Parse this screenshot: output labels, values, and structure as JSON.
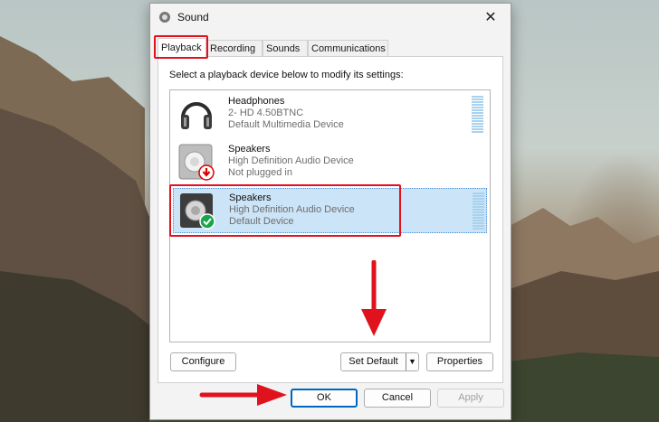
{
  "dialog": {
    "title": "Sound",
    "close_glyph": "✕"
  },
  "tabs": [
    {
      "label": "Playback",
      "active": true
    },
    {
      "label": "Recording"
    },
    {
      "label": "Sounds"
    },
    {
      "label": "Communications"
    }
  ],
  "instruction": "Select a playback device below to modify its settings:",
  "devices": [
    {
      "name": "Headphones",
      "description": "2- HD 4.50BTNC",
      "status": "Default Multimedia Device",
      "icon": "headphones-icon",
      "badge": "none"
    },
    {
      "name": "Speakers",
      "description": "High Definition Audio Device",
      "status": "Not plugged in",
      "icon": "speaker-icon",
      "badge": "unplugged-arrow-icon"
    },
    {
      "name": "Speakers",
      "description": "High Definition Audio Device",
      "status": "Default Device",
      "icon": "speaker-icon",
      "badge": "default-check-icon",
      "selected": true
    }
  ],
  "panel_buttons": {
    "configure": "Configure",
    "set_default": "Set Default",
    "properties": "Properties"
  },
  "footer_buttons": {
    "ok": "OK",
    "cancel": "Cancel",
    "apply": "Apply"
  },
  "colors": {
    "accent": "#0067c0",
    "selection": "#cce4f7",
    "annotation_red": "#e0121e",
    "check_green": "#19a64b"
  }
}
